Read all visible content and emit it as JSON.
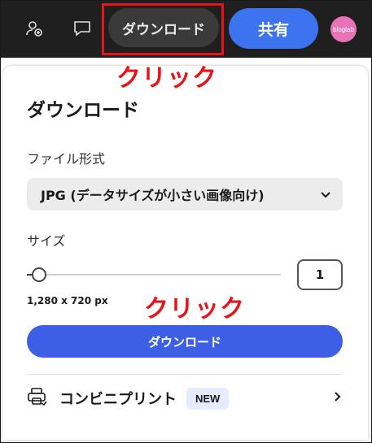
{
  "topbar": {
    "icons": [
      "add-user-icon",
      "comment-icon"
    ],
    "download_label": "ダウンロード",
    "share_label": "共有",
    "avatar_text": "bloglab"
  },
  "annotations": {
    "click_top": "クリック",
    "click_bottom": "クリック",
    "highlight_color": "#e8141c"
  },
  "panel": {
    "title": "ダウンロード",
    "file_format_label": "ファイル形式",
    "file_format_value": "JPG (データサイズが小さい画像向け)",
    "size_label": "サイズ",
    "size_scale": 1,
    "size_value": "1",
    "dimensions": "1,280 x 720 px",
    "download_button": "ダウンロード",
    "print_label": "コンビニプリント",
    "new_badge": "NEW"
  },
  "colors": {
    "accent": "#3d5fe6",
    "topbar_bg": "#1f1f1f",
    "share_bg": "#3d73ef"
  }
}
